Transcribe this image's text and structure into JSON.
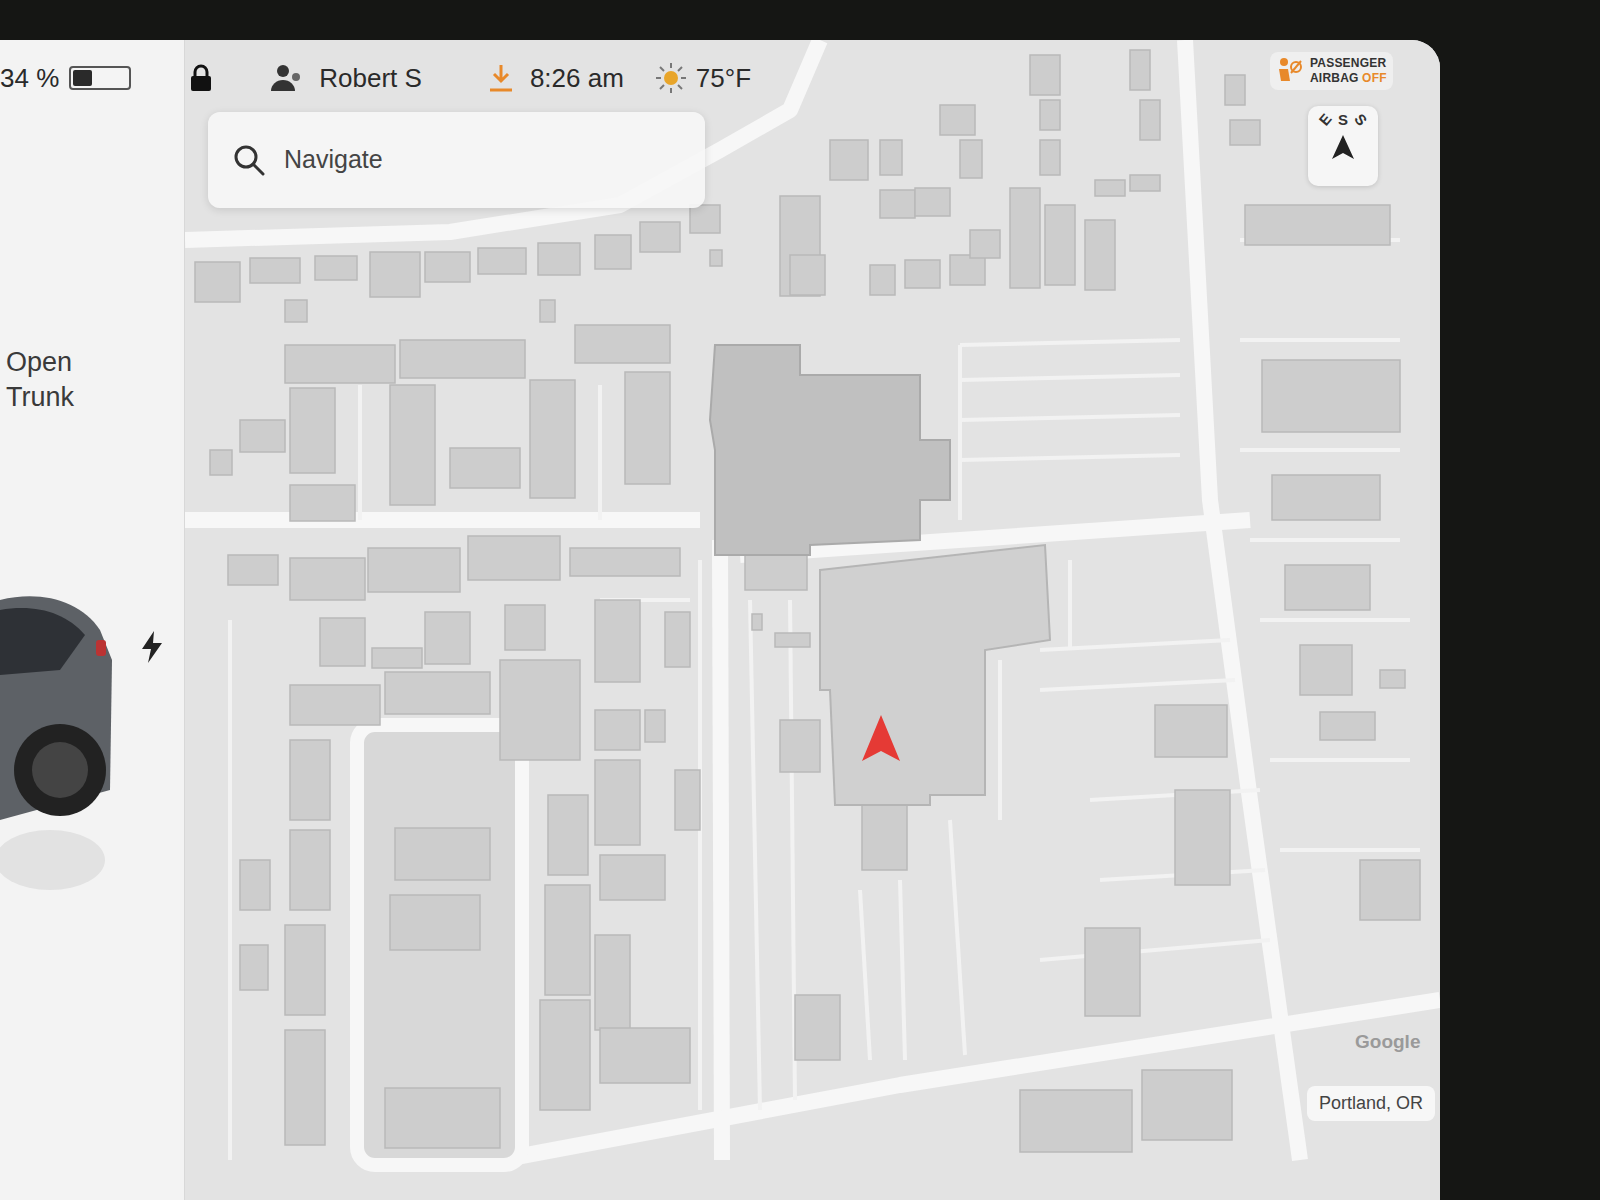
{
  "status_bar": {
    "battery": {
      "reading": "34 %",
      "level": 0.34
    },
    "locked": true,
    "driver": "Robert S",
    "update_available": true,
    "time": "8:26 am",
    "temperature": "75°F"
  },
  "airbag": {
    "lines": [
      "PASSENGER",
      "AIRBAG"
    ],
    "state": "OFF",
    "off": true
  },
  "search": {
    "placeholder": "Navigate"
  },
  "compass": {
    "labels": [
      "E",
      "S",
      "S"
    ]
  },
  "vehicle": {
    "trunk_action": "Open Trunk",
    "charging": true
  },
  "map": {
    "attribution": "Google",
    "location": "Portland, OR"
  }
}
